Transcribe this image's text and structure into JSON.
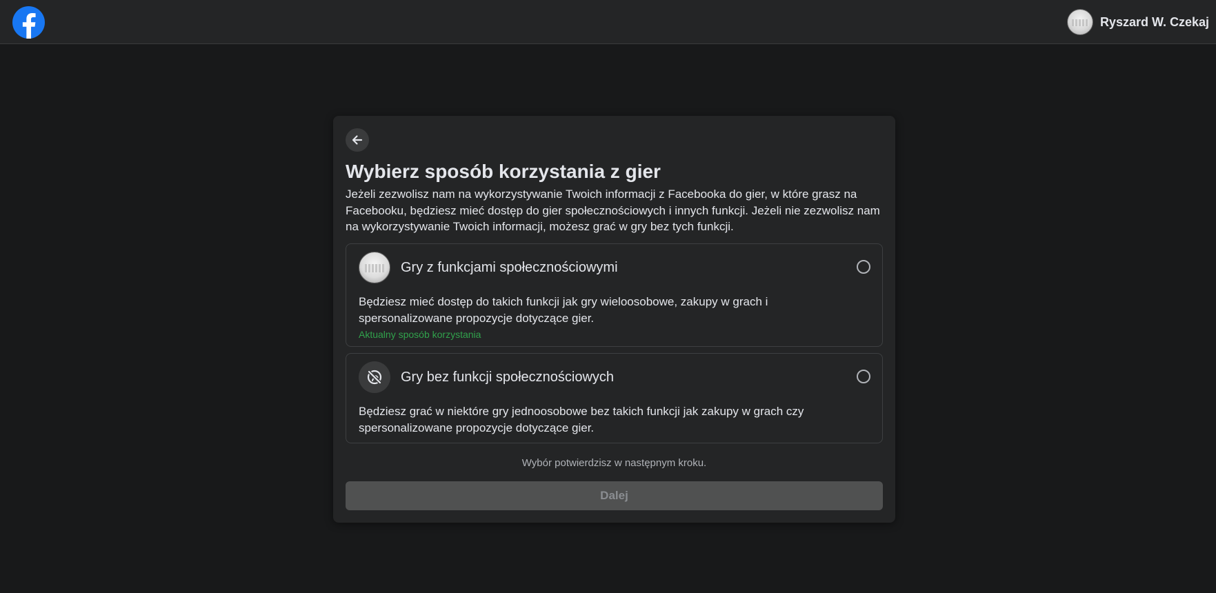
{
  "header": {
    "logo_icon": "facebook-logo-icon",
    "brand_color": "#1877f2",
    "user_name": "Ryszard W. Czekaj"
  },
  "dialog": {
    "back_icon": "arrow-left-icon",
    "title": "Wybierz sposób korzystania z gier",
    "description": "Jeżeli zezwolisz nam na wykorzystywanie Twoich informacji z Facebooka do gier, w które grasz na Facebooku, będziesz mieć dostęp do gier społecznościowych i innych funkcji. Jeżeli nie zezwolisz nam na wykorzystywanie Twoich informacji, możesz grać w gry bez tych funkcji.",
    "options": [
      {
        "icon": "avatar",
        "title": "Gry z funkcjami społecznościowymi",
        "description": "Będziesz mieć dostęp do takich funkcji jak gry wieloosobowe, zakupy w grach i spersonalizowane propozycje dotyczące gier.",
        "status": "Aktualny sposób korzystania",
        "selected": false
      },
      {
        "icon": "no-sharing-icon",
        "title": "Gry bez funkcji społecznościowych",
        "description": "Będziesz grać w niektóre gry jednoosobowe bez takich funkcji jak zakupy w grach czy spersonalizowane propozycje dotyczące gier.",
        "selected": false
      }
    ],
    "note": "Wybór potwierdzisz w następnym kroku.",
    "next_label": "Dalej",
    "status_color": "#31a24c"
  }
}
